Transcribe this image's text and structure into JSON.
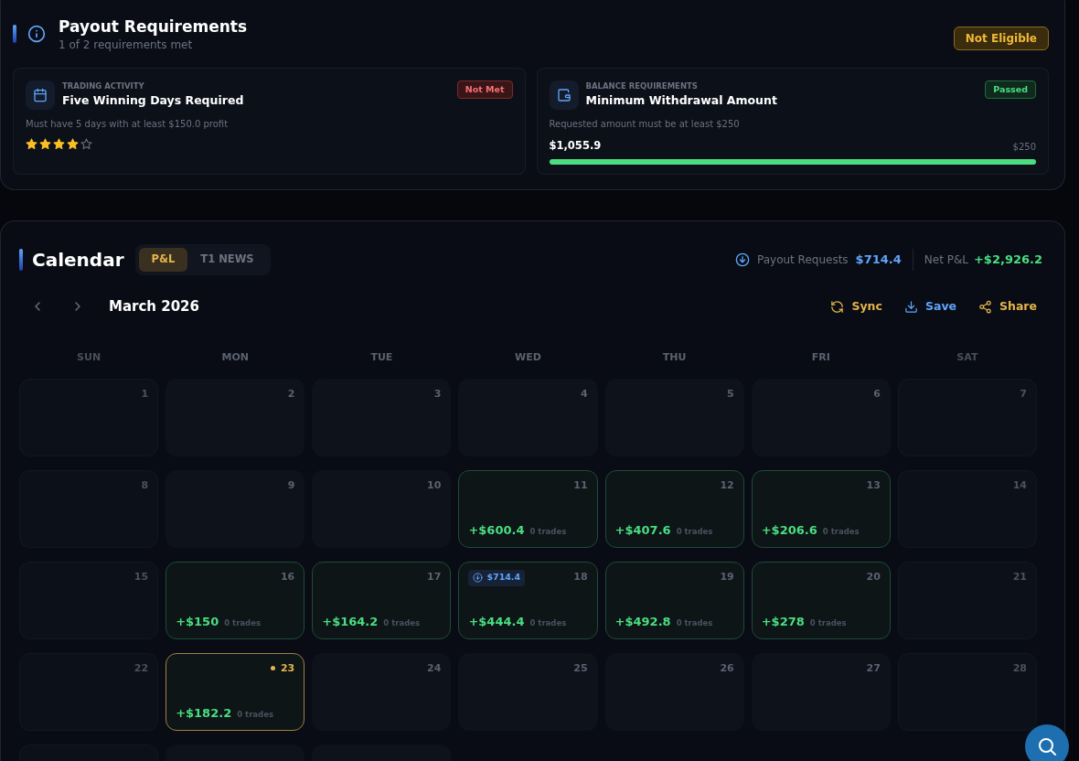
{
  "payout_requirements": {
    "title": "Payout Requirements",
    "subtitle": "1 of 2 requirements met",
    "status": {
      "label": "Not Eligible",
      "kind": "warning"
    },
    "requirements": [
      {
        "category": "TRADING ACTIVITY",
        "title": "Five Winning Days Required",
        "badge": {
          "label": "Not Met",
          "kind": "fail"
        },
        "description": "Must have 5 days with at least $150.0 profit",
        "kind": "stars",
        "stars": 4
      },
      {
        "category": "BALANCE REQUIREMENTS",
        "title": "Minimum Withdrawal Amount",
        "badge": {
          "label": "Passed",
          "kind": "pass"
        },
        "description": "Requested amount must be at least $250",
        "kind": "progress",
        "value": "$1,055.9",
        "target": "$250",
        "level": 1
      }
    ]
  },
  "calendar": {
    "title": "Calendar",
    "tabs": [
      {
        "label": "P&L",
        "selected": true
      },
      {
        "label": "T1 NEWS",
        "selected": false
      }
    ],
    "payout_requests": {
      "label": "Payout Requests",
      "value": "$714.4"
    },
    "net_pnl": {
      "label": "Net P&L",
      "value": "+$2,926.2"
    },
    "month": "March 2026",
    "actions": [
      {
        "kind": "sync",
        "label": "Sync"
      },
      {
        "kind": "save",
        "label": "Save"
      },
      {
        "kind": "share",
        "label": "Share"
      }
    ],
    "weekdays": [
      "SUN",
      "MON",
      "TUE",
      "WED",
      "THU",
      "FRI",
      "SAT"
    ],
    "weeks": [
      [
        {
          "kind": "weekend",
          "day": "1"
        },
        {
          "kind": "empty",
          "day": "2"
        },
        {
          "kind": "empty",
          "day": "3"
        },
        {
          "kind": "empty",
          "day": "4"
        },
        {
          "kind": "empty",
          "day": "5"
        },
        {
          "kind": "empty",
          "day": "6"
        },
        {
          "kind": "weekend",
          "day": "7"
        }
      ],
      [
        {
          "kind": "weekend",
          "day": "8"
        },
        {
          "kind": "empty",
          "day": "9"
        },
        {
          "kind": "empty",
          "day": "10"
        },
        {
          "kind": "profit",
          "day": "11",
          "pnl": "+$600.4",
          "trades": "0 trades"
        },
        {
          "kind": "profit",
          "day": "12",
          "pnl": "+$407.6",
          "trades": "0 trades"
        },
        {
          "kind": "profit",
          "day": "13",
          "pnl": "+$206.6",
          "trades": "0 trades"
        },
        {
          "kind": "weekend",
          "day": "14"
        }
      ],
      [
        {
          "kind": "weekend",
          "day": "15"
        },
        {
          "kind": "profit",
          "day": "16",
          "pnl": "+$150",
          "trades": "0 trades"
        },
        {
          "kind": "profit",
          "day": "17",
          "pnl": "+$164.2",
          "trades": "0 trades"
        },
        {
          "kind": "profit",
          "day": "18",
          "pnl": "+$444.4",
          "trades": "0 trades",
          "payout": "$714.4"
        },
        {
          "kind": "profit",
          "day": "19",
          "pnl": "+$492.8",
          "trades": "0 trades"
        },
        {
          "kind": "profit",
          "day": "20",
          "pnl": "+$278",
          "trades": "0 trades"
        },
        {
          "kind": "weekend",
          "day": "21"
        }
      ],
      [
        {
          "kind": "weekend",
          "day": "22"
        },
        {
          "kind": "profit",
          "day": "23",
          "pnl": "+$182.2",
          "trades": "0 trades",
          "today": true
        },
        {
          "kind": "empty",
          "day": "24"
        },
        {
          "kind": "empty",
          "day": "25"
        },
        {
          "kind": "empty",
          "day": "26"
        },
        {
          "kind": "empty",
          "day": "27"
        },
        {
          "kind": "weekend",
          "day": "28"
        }
      ],
      [
        {
          "kind": "weekend"
        },
        {
          "kind": "empty"
        },
        {
          "kind": "empty"
        }
      ]
    ]
  }
}
